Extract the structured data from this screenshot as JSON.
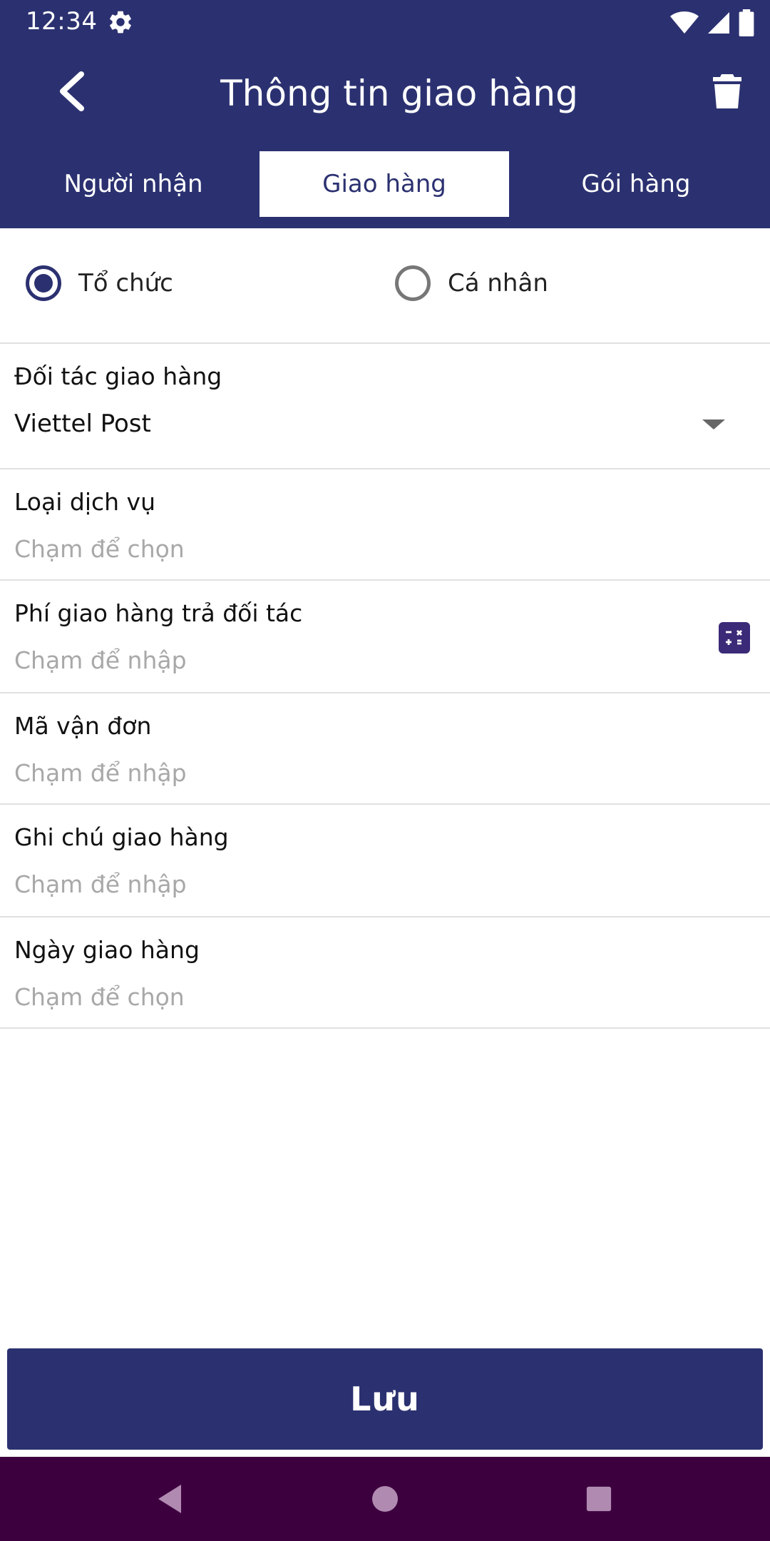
{
  "status_bar": {
    "time": "12:34"
  },
  "app_bar": {
    "title": "Thông tin giao hàng"
  },
  "tabs": [
    {
      "label": "Người nhận",
      "active": false
    },
    {
      "label": "Giao hàng",
      "active": true
    },
    {
      "label": "Gói hàng",
      "active": false
    }
  ],
  "customer_type": {
    "options": [
      {
        "label": "Tổ chức",
        "selected": true
      },
      {
        "label": "Cá nhân",
        "selected": false
      }
    ]
  },
  "form": {
    "partner": {
      "label": "Đối tác giao hàng",
      "value": "Viettel Post"
    },
    "service_type": {
      "label": "Loại dịch vụ",
      "placeholder": "Chạm để chọn"
    },
    "shipping_fee": {
      "label": "Phí giao hàng trả đối tác",
      "placeholder": "Chạm để nhập"
    },
    "tracking_code": {
      "label": "Mã vận đơn",
      "placeholder": "Chạm để nhập"
    },
    "delivery_note": {
      "label": "Ghi chú giao hàng",
      "placeholder": "Chạm để nhập"
    },
    "delivery_date": {
      "label": "Ngày giao hàng",
      "placeholder": "Chạm để chọn"
    }
  },
  "save_button": {
    "label": "Lưu"
  },
  "colors": {
    "primary": "#2b3170",
    "nav_bar": "#3d003f",
    "placeholder": "#a8a8a8"
  },
  "icons": [
    "settings-icon",
    "wifi-icon",
    "signal-icon",
    "battery-icon",
    "back-arrow-icon",
    "trash-icon",
    "dropdown-arrow-icon",
    "calculator-icon",
    "nav-back-icon",
    "nav-home-icon",
    "nav-recents-icon"
  ]
}
